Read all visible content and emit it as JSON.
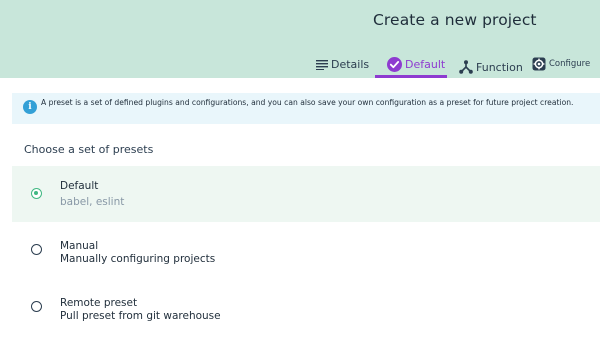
{
  "header": {
    "title": "Create a new project",
    "tabs": [
      {
        "label": "Details",
        "icon": "list-icon"
      },
      {
        "label": "Default",
        "icon": "check-circle-icon",
        "active": true
      },
      {
        "label": "Function",
        "icon": "fork-icon"
      },
      {
        "label": "Configure",
        "icon": "gear-icon"
      }
    ]
  },
  "info": {
    "icon": "info-icon",
    "text": "A preset is a set of defined plugins and configurations, and you can also save your own configuration as a preset for future project creation."
  },
  "section_title": "Choose a set of presets",
  "presets": [
    {
      "name": "Default",
      "description": "babel, eslint",
      "selected": true
    },
    {
      "name": "Manual",
      "description": "Manually configuring projects",
      "selected": false
    },
    {
      "name": "Remote preset",
      "description": "Pull preset from git warehouse",
      "selected": false
    }
  ],
  "colors": {
    "header_bg": "#c8e6da",
    "accent_purple": "#8e3bd0",
    "accent_green": "#41b883",
    "info_bg": "#e9f6fb",
    "info_icon": "#33a0d6"
  }
}
